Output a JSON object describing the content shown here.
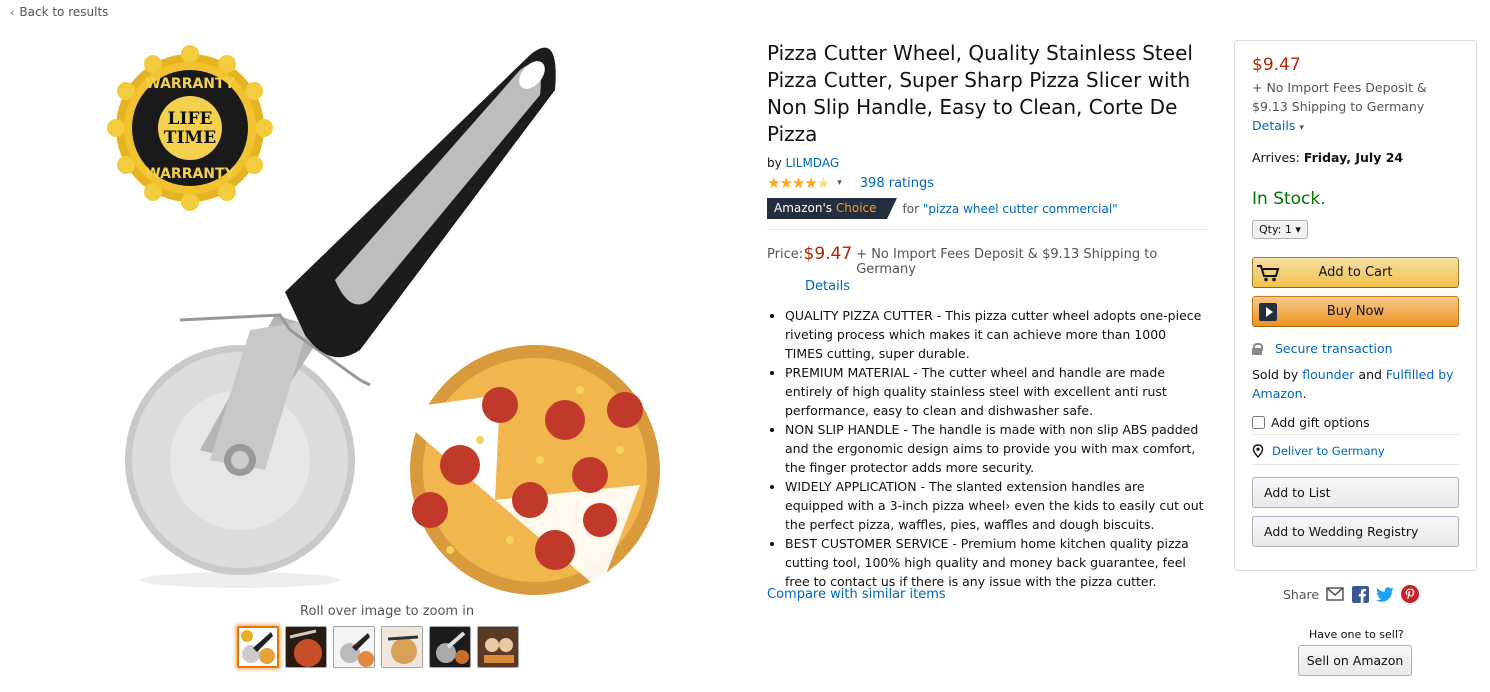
{
  "nav": {
    "back_label": "Back to results"
  },
  "gallery": {
    "badge_top": "WARRANTY",
    "badge_mid1": "LIFE",
    "badge_mid2": "TIME",
    "badge_bottom": "WARRANTY",
    "zoom_hint": "Roll over image to zoom in",
    "thumb_count": 6,
    "selected_thumb": 1
  },
  "product": {
    "title": "Pizza Cutter Wheel, Quality Stainless Steel Pizza Cutter, Super Sharp Pizza Slicer with Non Slip Handle, Easy to Clean, Corte De Pizza",
    "by_prefix": "by",
    "brand": "LILMDAG",
    "rating_stars": 4.5,
    "ratings_text": "398 ratings",
    "choice_label_1": "Amazon's",
    "choice_label_2": "Choice",
    "choice_for": "for",
    "choice_query": "\"pizza wheel cutter commercial\"",
    "price_label": "Price:",
    "price": "$9.47",
    "price_shipping": "+ No Import Fees Deposit & $9.13 Shipping to Germany",
    "details_link": "Details",
    "bullets": [
      "QUALITY PIZZA CUTTER - This pizza cutter wheel adopts one-piece riveting process which makes it can achieve more than 1000 TIMES cutting, super durable.",
      "PREMIUM MATERIAL - The cutter wheel and handle are made entirely of high quality stainless steel with excellent anti rust performance, easy to clean and dishwasher safe.",
      "NON SLIP HANDLE - The handle is made with non slip ABS padded and the ergonomic design aims to provide you with max comfort, the finger protector adds more security.",
      "WIDELY APPLICATION - The slanted extension handles are equipped with a 3-inch pizza wheel› even the kids to easily cut out the perfect pizza, waffles, pies, waffles and dough biscuits.",
      "BEST CUSTOMER SERVICE - Premium home kitchen quality pizza cutting tool, 100% high quality and money back guarantee, feel free to contact us if there is any issue with the pizza cutter."
    ],
    "compare_link": "Compare with similar items"
  },
  "buybox": {
    "price": "$9.47",
    "shipping_text": "+ No Import Fees Deposit & $9.13 Shipping to Germany",
    "details_link": "Details",
    "arrives_label": "Arrives:",
    "arrives_date": "Friday, July 24",
    "stock": "In Stock.",
    "qty": "Qty: 1",
    "add_to_cart": "Add to Cart",
    "buy_now": "Buy Now",
    "secure": "Secure transaction",
    "sold_by_prefix": "Sold by",
    "seller": "flounder",
    "and": "and",
    "fulfilled": "Fulfilled by Amazon",
    "gift": "Add gift options",
    "deliver": "Deliver to Germany",
    "add_list": "Add to List",
    "add_registry": "Add to Wedding Registry"
  },
  "share": {
    "label": "Share"
  },
  "sell": {
    "question": "Have one to sell?",
    "button": "Sell on Amazon"
  },
  "colors": {
    "link": "#0066c0",
    "price": "#b12704",
    "stock": "#007600",
    "star": "#ffa41c",
    "facebook": "#3b5998",
    "twitter": "#1da1f2",
    "pinterest": "#cb2027"
  }
}
